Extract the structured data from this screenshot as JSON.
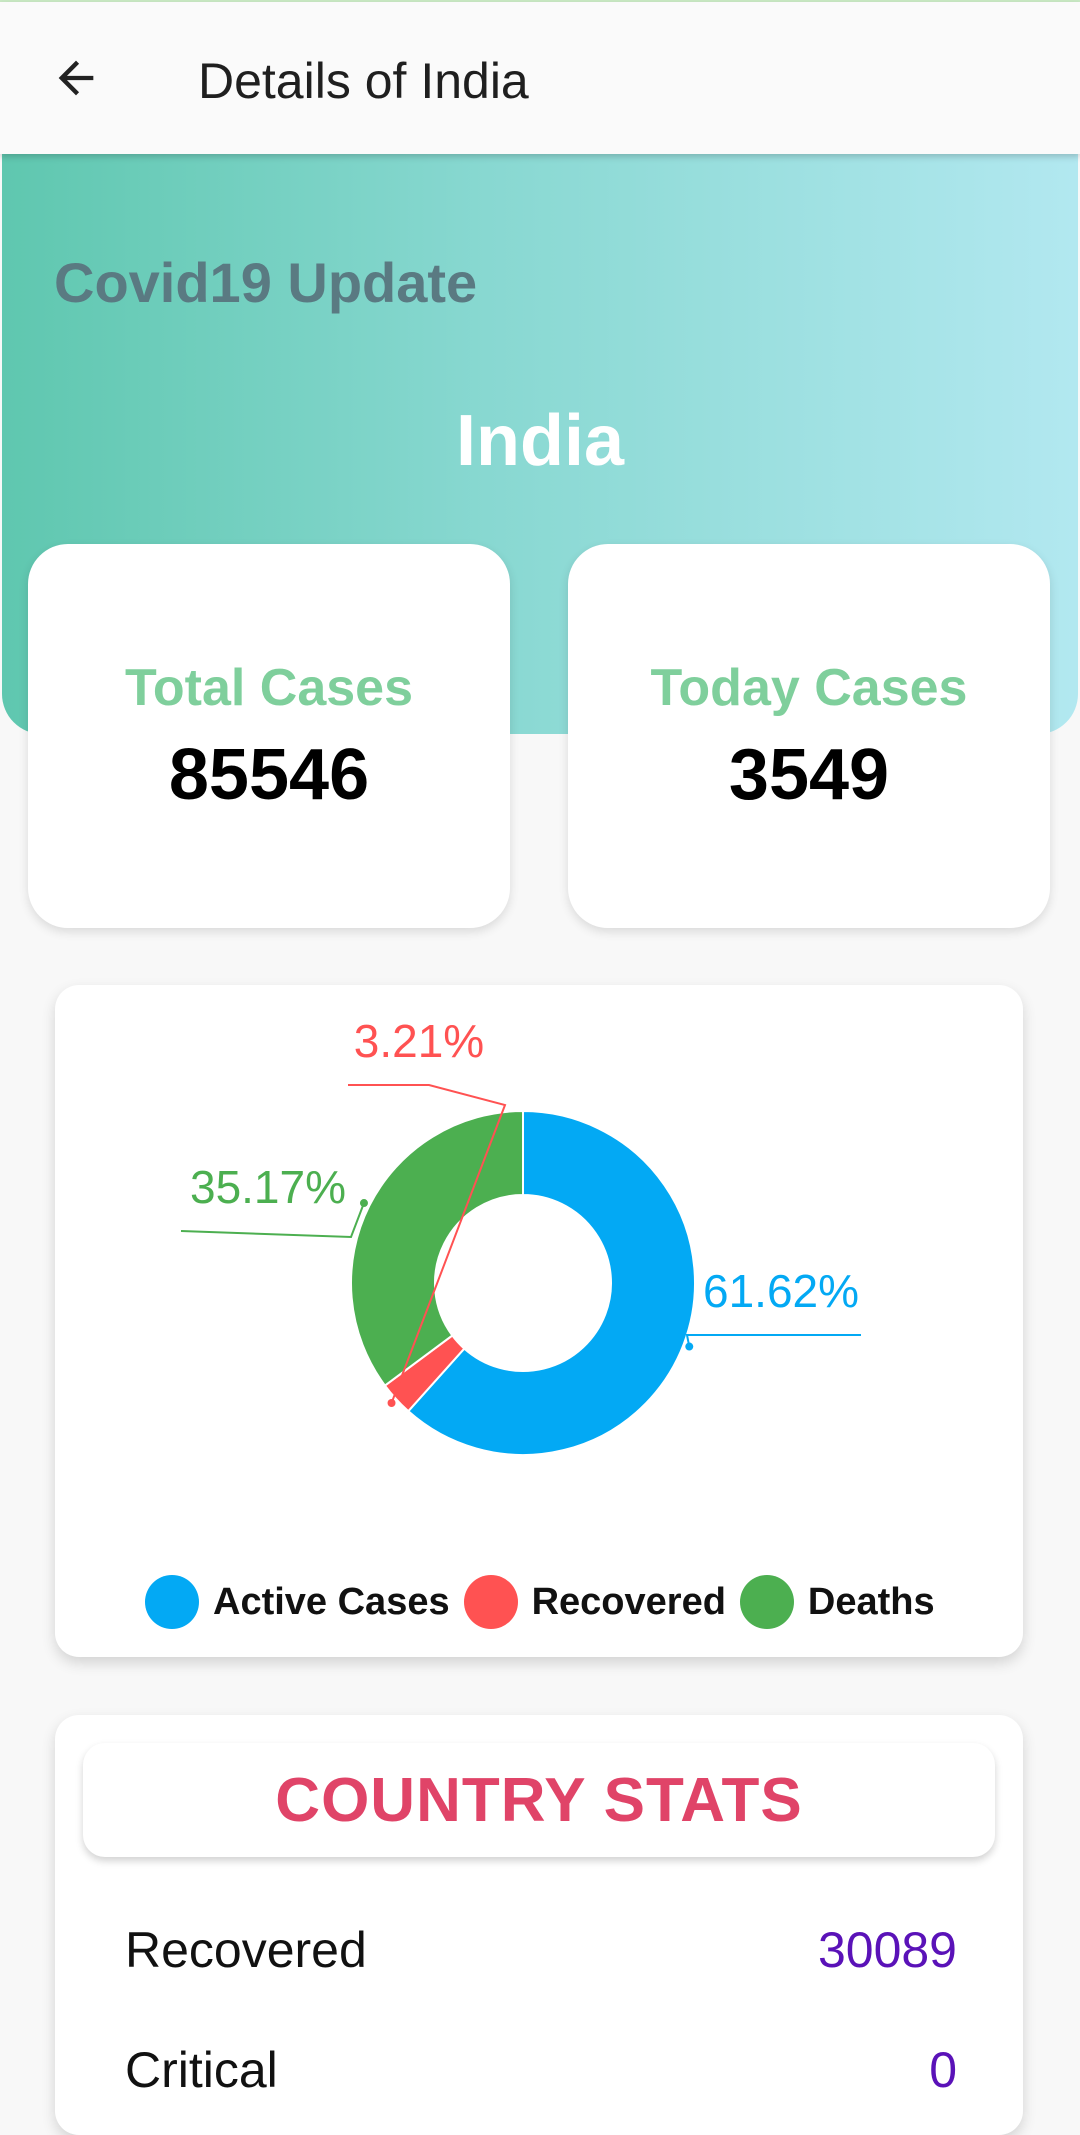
{
  "appbar": {
    "title": "Details of India"
  },
  "hero": {
    "subtitle": "Covid19 Update",
    "country": "India"
  },
  "cards": {
    "total": {
      "label": "Total Cases",
      "value": "85546"
    },
    "today": {
      "label": "Today Cases",
      "value": "3549"
    }
  },
  "chart_data": {
    "type": "pie",
    "donut": true,
    "categories": [
      "Active Cases",
      "Recovered",
      "Deaths"
    ],
    "values": [
      61.62,
      3.21,
      35.17
    ],
    "value_labels": [
      "61.62%",
      "3.21%",
      "35.17%"
    ],
    "colors": [
      "#03a9f4",
      "#ff5252",
      "#4caf50"
    ],
    "legend_position": "bottom"
  },
  "country_stats": {
    "title": "COUNTRY STATS",
    "rows": [
      {
        "label": "Recovered",
        "value": "30089"
      },
      {
        "label": "Critical",
        "value": "0"
      }
    ]
  }
}
